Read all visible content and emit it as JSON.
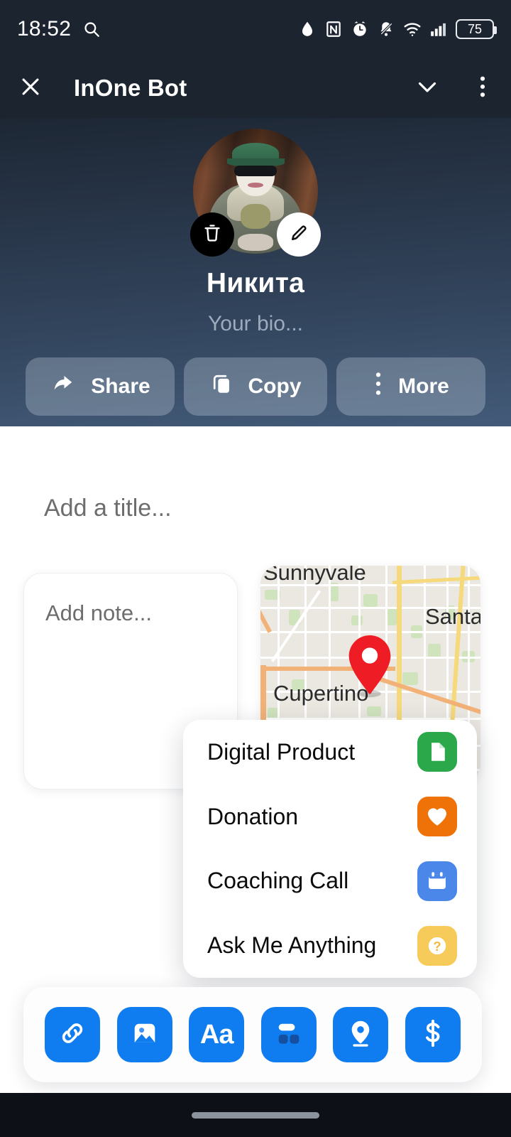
{
  "status_bar": {
    "time": "18:52",
    "battery_level": "75",
    "icons": [
      "search-icon",
      "water-drop-icon",
      "nfc-icon",
      "alarm-clock-icon",
      "bell-off-icon",
      "wifi-icon",
      "cellular-signal-icon",
      "battery-icon"
    ]
  },
  "app_bar": {
    "close_icon": "close-icon",
    "title": "InOne Bot",
    "collapse_icon": "chevron-down-icon",
    "menu_icon": "more-vertical-icon"
  },
  "profile": {
    "avatar_alt": "person in green cap, sunglasses and white face mask sitting on a brown leather chair",
    "delete_icon": "trash-icon",
    "edit_icon": "pencil-icon",
    "name": "Никита",
    "bio_placeholder": "Your bio...",
    "actions": [
      {
        "label": "Share",
        "icon": "share-arrow-icon"
      },
      {
        "label": "Copy",
        "icon": "copy-icon"
      },
      {
        "label": "More",
        "icon": "more-vertical-icon"
      }
    ],
    "gradient_top": "#1d2734",
    "gradient_bottom": "#435b79"
  },
  "editor": {
    "title_placeholder": "Add a title...",
    "note_placeholder": "Add note...",
    "map_card": {
      "pin_icon": "map-pin-icon",
      "pin_color": "#ee1c25",
      "labels": [
        "Sunnyvale",
        "Santa",
        "Cupertino"
      ]
    }
  },
  "popup_menu": {
    "items": [
      {
        "label": "Digital Product",
        "icon": "document-icon",
        "color": "#2ba84a"
      },
      {
        "label": "Donation",
        "icon": "heart-icon",
        "color": "#ef7209"
      },
      {
        "label": "Coaching Call",
        "icon": "calendar-icon",
        "color": "#4b87e8"
      },
      {
        "label": "Ask Me Anything",
        "icon": "question-mark-icon",
        "color": "#f7cb5a"
      }
    ]
  },
  "toolbar": {
    "accent_color": "#0f7df0",
    "buttons": [
      {
        "icon": "link-icon",
        "name": "insert-link-button"
      },
      {
        "icon": "image-icon",
        "name": "insert-image-button"
      },
      {
        "icon": "text-icon",
        "name": "insert-text-button",
        "label": "Aa"
      },
      {
        "icon": "blocks-icon",
        "name": "insert-blocks-button"
      },
      {
        "icon": "location-pin-icon",
        "name": "insert-location-button"
      },
      {
        "icon": "dollar-icon",
        "name": "insert-payment-button"
      }
    ]
  },
  "nav_bar": {
    "gesture_pill": "home-gesture-pill"
  }
}
